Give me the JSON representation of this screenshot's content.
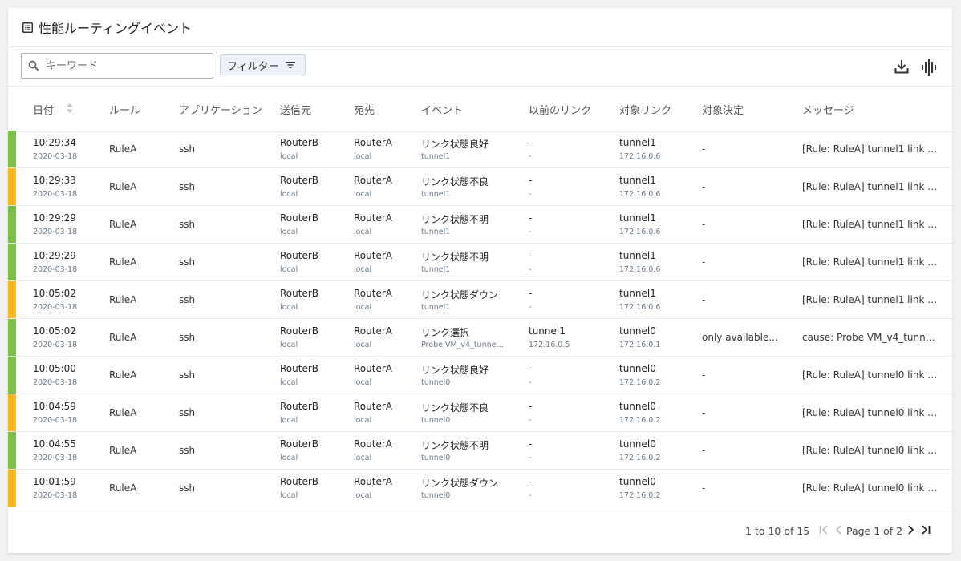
{
  "header": {
    "title": "性能ルーティングイベント",
    "icon": "table-list-icon"
  },
  "toolbar": {
    "search_placeholder": "キーワード",
    "search_value": "",
    "filter_label": "フィルター",
    "icons": [
      "search-icon",
      "filter-icon",
      "download-icon",
      "waveform-icon"
    ]
  },
  "columns": {
    "date": "日付",
    "rule": "ルール",
    "app": "アプリケーション",
    "src": "送信元",
    "dst": "宛先",
    "event": "イベント",
    "prev_link": "以前のリンク",
    "target_link": "対象リンク",
    "decision": "対象決定",
    "message": "メッセージ"
  },
  "colors": {
    "green": "#7ac143",
    "orange": "#ffb81c"
  },
  "rows": [
    {
      "status": "green",
      "time": "10:29:34",
      "date": "2020-03-18",
      "rule": "RuleA",
      "app": "ssh",
      "src": "RouterB",
      "src_sub": "local",
      "dst": "RouterA",
      "dst_sub": "local",
      "event": "リンク状態良好",
      "event_sub": "tunnel1",
      "prev": "-",
      "prev_sub": "-",
      "target": "tunnel1",
      "target_sub": "172.16.0.6",
      "decision": "-",
      "message": "[Rule: RuleA] tunnel1 link st..."
    },
    {
      "status": "orange",
      "time": "10:29:33",
      "date": "2020-03-18",
      "rule": "RuleA",
      "app": "ssh",
      "src": "RouterB",
      "src_sub": "local",
      "dst": "RouterA",
      "dst_sub": "local",
      "event": "リンク状態不良",
      "event_sub": "tunnel1",
      "prev": "-",
      "prev_sub": "-",
      "target": "tunnel1",
      "target_sub": "172.16.0.6",
      "decision": "-",
      "message": "[Rule: RuleA] tunnel1 link st..."
    },
    {
      "status": "green",
      "time": "10:29:29",
      "date": "2020-03-18",
      "rule": "RuleA",
      "app": "ssh",
      "src": "RouterB",
      "src_sub": "local",
      "dst": "RouterA",
      "dst_sub": "local",
      "event": "リンク状態不明",
      "event_sub": "tunnel1",
      "prev": "-",
      "prev_sub": "-",
      "target": "tunnel1",
      "target_sub": "172.16.0.6",
      "decision": "-",
      "message": "[Rule: RuleA] tunnel1 link st..."
    },
    {
      "status": "green",
      "time": "10:29:29",
      "date": "2020-03-18",
      "rule": "RuleA",
      "app": "ssh",
      "src": "RouterB",
      "src_sub": "local",
      "dst": "RouterA",
      "dst_sub": "local",
      "event": "リンク状態不明",
      "event_sub": "tunnel1",
      "prev": "-",
      "prev_sub": "-",
      "target": "tunnel1",
      "target_sub": "172.16.0.6",
      "decision": "-",
      "message": "[Rule: RuleA] tunnel1 link st..."
    },
    {
      "status": "orange",
      "time": "10:05:02",
      "date": "2020-03-18",
      "rule": "RuleA",
      "app": "ssh",
      "src": "RouterB",
      "src_sub": "local",
      "dst": "RouterA",
      "dst_sub": "local",
      "event": "リンク状態ダウン",
      "event_sub": "tunnel1",
      "prev": "-",
      "prev_sub": "-",
      "target": "tunnel1",
      "target_sub": "172.16.0.6",
      "decision": "-",
      "message": "[Rule: RuleA] tunnel1 link st..."
    },
    {
      "status": "green",
      "time": "10:05:02",
      "date": "2020-03-18",
      "rule": "RuleA",
      "app": "ssh",
      "src": "RouterB",
      "src_sub": "local",
      "dst": "RouterA",
      "dst_sub": "local",
      "event": "リンク選択",
      "event_sub": "Probe VM_v4_tunnel...",
      "prev": "tunnel1",
      "prev_sub": "172.16.0.5",
      "target": "tunnel0",
      "target_sub": "172.16.0.1",
      "decision": "only available...",
      "message": "cause: Probe VM_v4_tunnel..."
    },
    {
      "status": "green",
      "time": "10:05:00",
      "date": "2020-03-18",
      "rule": "RuleA",
      "app": "ssh",
      "src": "RouterB",
      "src_sub": "local",
      "dst": "RouterA",
      "dst_sub": "local",
      "event": "リンク状態良好",
      "event_sub": "tunnel0",
      "prev": "-",
      "prev_sub": "-",
      "target": "tunnel0",
      "target_sub": "172.16.0.2",
      "decision": "-",
      "message": "[Rule: RuleA] tunnel0 link st..."
    },
    {
      "status": "orange",
      "time": "10:04:59",
      "date": "2020-03-18",
      "rule": "RuleA",
      "app": "ssh",
      "src": "RouterB",
      "src_sub": "local",
      "dst": "RouterA",
      "dst_sub": "local",
      "event": "リンク状態不良",
      "event_sub": "tunnel0",
      "prev": "-",
      "prev_sub": "-",
      "target": "tunnel0",
      "target_sub": "172.16.0.2",
      "decision": "-",
      "message": "[Rule: RuleA] tunnel0 link st..."
    },
    {
      "status": "green",
      "time": "10:04:55",
      "date": "2020-03-18",
      "rule": "RuleA",
      "app": "ssh",
      "src": "RouterB",
      "src_sub": "local",
      "dst": "RouterA",
      "dst_sub": "local",
      "event": "リンク状態不明",
      "event_sub": "tunnel0",
      "prev": "-",
      "prev_sub": "-",
      "target": "tunnel0",
      "target_sub": "172.16.0.2",
      "decision": "-",
      "message": "[Rule: RuleA] tunnel0 link st..."
    },
    {
      "status": "orange",
      "time": "10:01:59",
      "date": "2020-03-18",
      "rule": "RuleA",
      "app": "ssh",
      "src": "RouterB",
      "src_sub": "local",
      "dst": "RouterA",
      "dst_sub": "local",
      "event": "リンク状態ダウン",
      "event_sub": "tunnel0",
      "prev": "-",
      "prev_sub": "-",
      "target": "tunnel0",
      "target_sub": "172.16.0.2",
      "decision": "-",
      "message": "[Rule: RuleA] tunnel0 link st..."
    }
  ],
  "footer": {
    "range": "1 to 10 of 15",
    "page": "Page 1 of 2"
  }
}
